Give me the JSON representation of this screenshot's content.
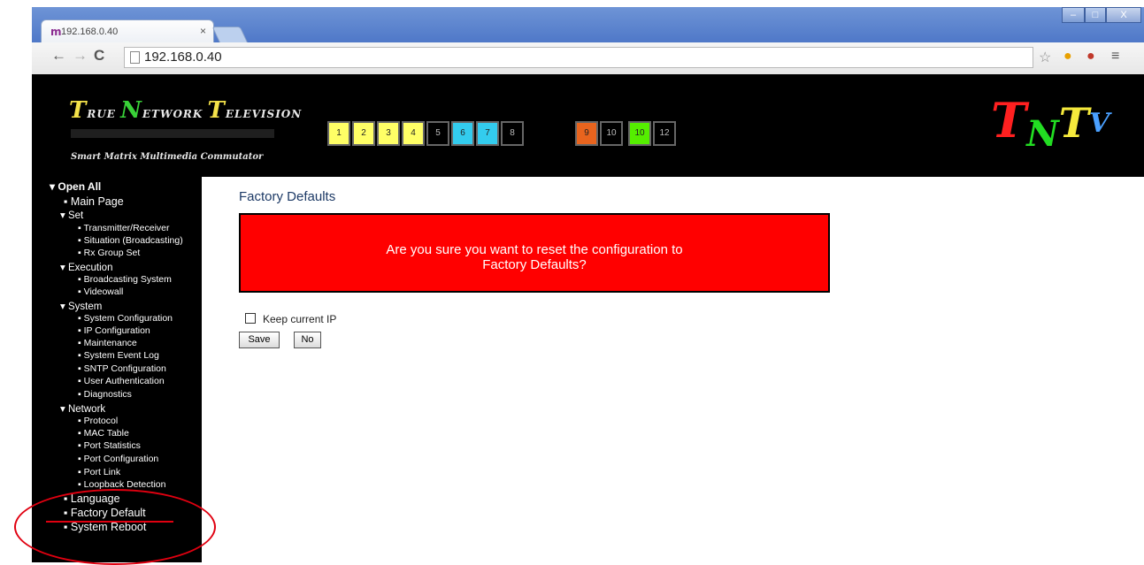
{
  "browser": {
    "tab_title": "192.168.0.40",
    "url": "192.168.0.40",
    "window_buttons": [
      "–",
      "□",
      "X"
    ]
  },
  "header": {
    "brand_words": [
      {
        "initial": "T",
        "rest": "RUE"
      },
      {
        "initial": "N",
        "rest": "ETWORK"
      },
      {
        "initial": "T",
        "rest": "ELEVISION"
      }
    ],
    "tagline": "Smart Matrix Multimedia Commutator",
    "port_buttons": [
      {
        "label": "1",
        "color": "#ffff66"
      },
      {
        "label": "2",
        "color": "#ffff66"
      },
      {
        "label": "3",
        "color": "#ffff66"
      },
      {
        "label": "4",
        "color": "#ffff66"
      },
      {
        "label": "5",
        "color": "#000000"
      },
      {
        "label": "6",
        "color": "#33ccee"
      },
      {
        "label": "7",
        "color": "#33ccee"
      },
      {
        "label": "8",
        "color": "#000000"
      },
      {
        "label": "9",
        "color": "#e8641e"
      },
      {
        "label": "10",
        "color": "#000000"
      },
      {
        "label": "10",
        "color": "#55ee00"
      },
      {
        "label": "12",
        "color": "#000000"
      }
    ],
    "logo_letters": [
      "T",
      "N",
      "T",
      "V"
    ]
  },
  "sidebar": {
    "items": [
      {
        "label": "Open All",
        "level": 0
      },
      {
        "label": "Main Page",
        "level": 1
      },
      {
        "label": "Set",
        "level": 1
      },
      {
        "label": "Transmitter/Receiver",
        "level": 2
      },
      {
        "label": "Situation (Broadcasting)",
        "level": 2
      },
      {
        "label": "Rx Group Set",
        "level": 2
      },
      {
        "label": "Execution",
        "level": 1
      },
      {
        "label": "Broadcasting System",
        "level": 2
      },
      {
        "label": "Videowall",
        "level": 2
      },
      {
        "label": "System",
        "level": 1
      },
      {
        "label": "System Configuration",
        "level": 2
      },
      {
        "label": "IP Configuration",
        "level": 2
      },
      {
        "label": "Maintenance",
        "level": 2
      },
      {
        "label": "System Event Log",
        "level": 2
      },
      {
        "label": "SNTP Configuration",
        "level": 2
      },
      {
        "label": "User Authentication",
        "level": 2
      },
      {
        "label": "Diagnostics",
        "level": 2
      },
      {
        "label": "Network",
        "level": 1
      },
      {
        "label": "Protocol",
        "level": 2
      },
      {
        "label": "MAC Table",
        "level": 2
      },
      {
        "label": "Port Statistics",
        "level": 2
      },
      {
        "label": "Port Configuration",
        "level": 2
      },
      {
        "label": "Port Link",
        "level": 2
      },
      {
        "label": "Loopback Detection",
        "level": 2
      },
      {
        "label": "Language",
        "level": 1
      },
      {
        "label": "Factory Default",
        "level": 1
      },
      {
        "label": "System Reboot",
        "level": 1
      }
    ]
  },
  "main": {
    "title": "Factory Defaults",
    "alert_line1": "Are you sure you want to reset the configuration to",
    "alert_line2": "Factory Defaults?",
    "keep_ip_label": "Keep current IP",
    "save_label": "Save",
    "no_label": "No"
  },
  "colors": {
    "alert_bg": "#ff0000",
    "annotation": "#e00010",
    "header_bg": "#000000"
  }
}
